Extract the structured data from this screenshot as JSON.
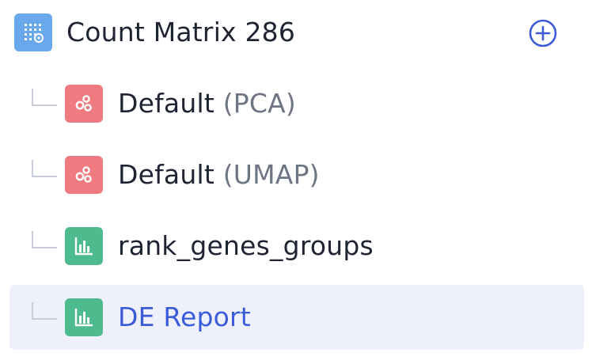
{
  "root": {
    "label": "Count Matrix 286",
    "icon": "matrix-icon",
    "icon_color": "#6aa8ec",
    "add_icon": "plus-circle-icon",
    "add_color": "#3b5bd8"
  },
  "children": [
    {
      "name": "Default",
      "suffix": "(PCA)",
      "icon": "embedding-icon",
      "icon_color": "#ef7a7f",
      "selected": false
    },
    {
      "name": "Default",
      "suffix": "(UMAP)",
      "icon": "embedding-icon",
      "icon_color": "#ef7a7f",
      "selected": false
    },
    {
      "name": "rank_genes_groups",
      "suffix": "",
      "icon": "bar-chart-icon",
      "icon_color": "#4dbb8e",
      "selected": false
    },
    {
      "name": "DE Report",
      "suffix": "",
      "icon": "bar-chart-icon",
      "icon_color": "#4dbb8e",
      "selected": true
    }
  ]
}
